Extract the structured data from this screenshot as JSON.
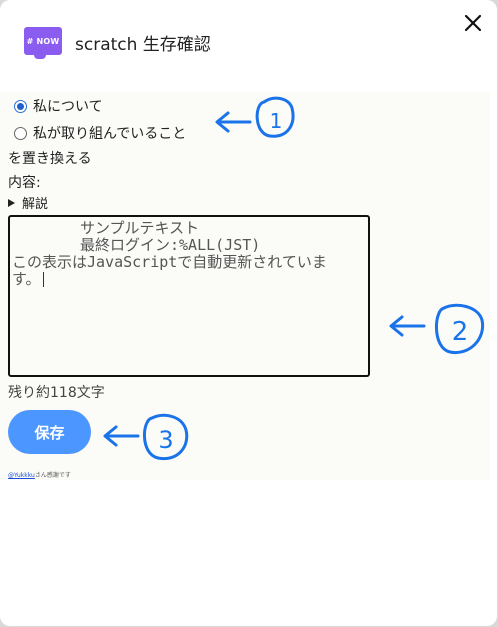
{
  "header": {
    "logo_text": "# NOW",
    "title": "scratch 生存確認"
  },
  "form": {
    "options": [
      {
        "label": "私について",
        "checked": true
      },
      {
        "label": "私が取り組んでいること",
        "checked": false
      }
    ],
    "replace_label": "を置き換える",
    "content_label": "内容:",
    "details_label": "解説",
    "textarea_lines": [
      "サンプルテキスト",
      "最終ログイン:%ALL(JST)",
      "この表示はJavaScriptで自動更新されていま",
      "す。"
    ],
    "remaining": "残り約118文字",
    "save_label": "保存",
    "credit_link": "@Yukkku",
    "credit_text": "さん感謝です"
  },
  "annotations": [
    "1",
    "2",
    "3"
  ],
  "colors": {
    "accent": "#4c97ff",
    "logo": "#8a5cf0",
    "annotation": "#1a73e8"
  }
}
